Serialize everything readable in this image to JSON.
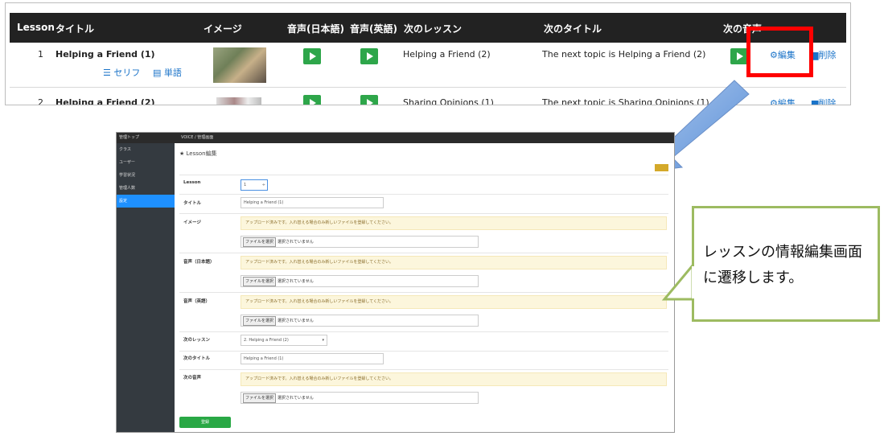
{
  "table": {
    "headers": [
      "Lesson",
      "タイトル",
      "イメージ",
      "音声(日本語)",
      "音声(英語)",
      "次のレッスン",
      "次のタイトル",
      "次の音声"
    ],
    "rows": [
      {
        "lesson": "1",
        "title": "Helping a Friend (1)",
        "next_lesson": "Helping a Friend (2)",
        "next_title": "The next topic is Helping a Friend (2)",
        "serif_link": "セリフ",
        "words_link": "単語"
      },
      {
        "lesson": "2",
        "title": "Helping a Friend (2)",
        "next_lesson": "Sharing Opinions (1)",
        "next_title": "The next topic is Sharing Opinions (1)"
      }
    ],
    "edit_label": "編集",
    "delete_label": "削除"
  },
  "admin": {
    "topbar_left": "管理トップ",
    "topbar_center": "VOICE / 管理画面",
    "sidebar": [
      "クラス",
      "ユーザー",
      "学習状況",
      "管理人数",
      "設定"
    ],
    "page_title": "Lesson編集",
    "fields": {
      "lesson_label": "Lesson",
      "lesson_value": "1",
      "title_label": "タイトル",
      "title_value": "Helping a Friend (1)",
      "image_label": "イメージ",
      "audio_jp_label": "音声（日本語）",
      "audio_en_label": "音声（英語）",
      "next_lesson_label": "次のレッスン",
      "next_lesson_value": "2. Helping a Friend (2)",
      "next_title_label": "次のタイトル",
      "next_title_value": "Helping a Friend (1)",
      "next_audio_label": "次の音声"
    },
    "upload_notice": "アップロード済みです。入れ替える場合のみ新しいファイルを登録してください。",
    "file_button": "ファイルを選択",
    "file_none": "選択されていません",
    "submit_label": "登録"
  },
  "callout": {
    "line1": "レッスンの情報編集画面",
    "line2": "に遷移します。"
  },
  "colors": {
    "header_bg": "#222222",
    "play_green": "#2ea64a",
    "highlight_red": "#ff0000",
    "link_blue": "#1a73c8",
    "callout_border": "#9dbb61",
    "sidebar_active": "#1e90ff"
  }
}
